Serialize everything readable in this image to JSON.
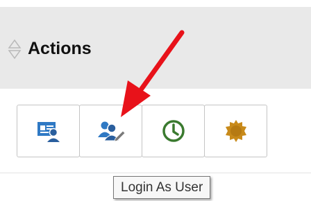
{
  "header": {
    "title": "Actions",
    "sort_icon": "sort-diamond-icon"
  },
  "actions": [
    {
      "name": "view-profile-button",
      "icon": "profile-card-icon",
      "color": "#2f79c4"
    },
    {
      "name": "login-as-user-button",
      "icon": "users-edit-icon",
      "color": "#2f79c4"
    },
    {
      "name": "history-button",
      "icon": "clock-icon",
      "color": "#3a7a2f"
    },
    {
      "name": "badge-button",
      "icon": "badge-seal-icon",
      "color": "#c88a1a"
    }
  ],
  "tooltip": {
    "text": "Login As User"
  },
  "annotation": {
    "icon": "red-arrow-icon",
    "color": "#e8121a"
  }
}
